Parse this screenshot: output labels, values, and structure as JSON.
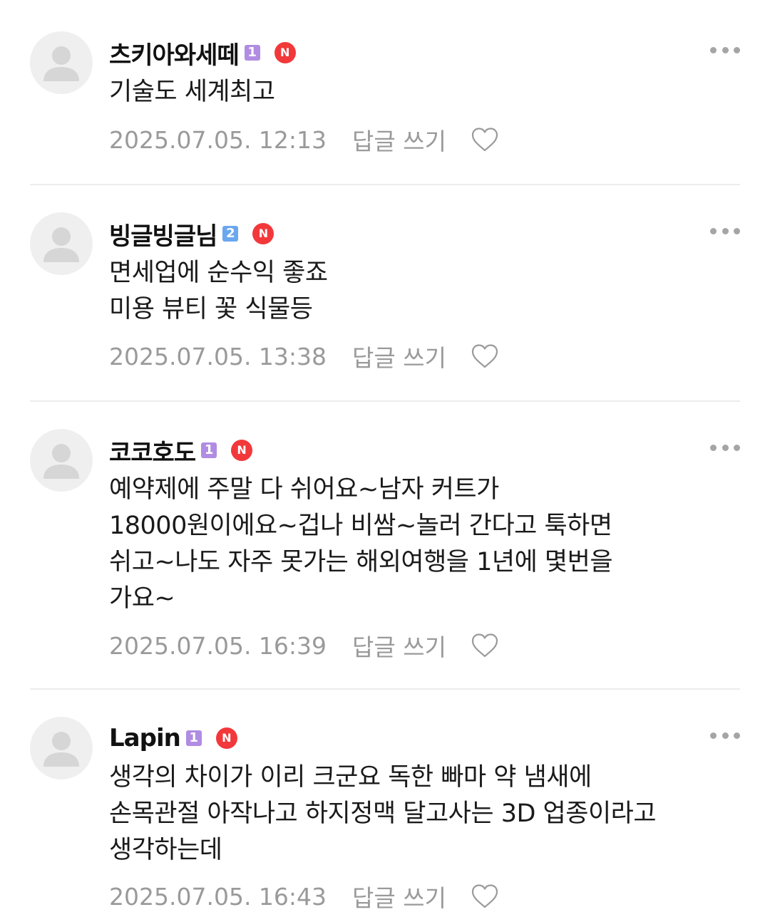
{
  "colors": {
    "grade_1": "#b08ce3",
    "grade_2": "#6aa7ee",
    "new_badge": "#f2383a",
    "meta_text": "#9a9a9a"
  },
  "reply_label": "답글 쓰기",
  "comments": [
    {
      "nickname": "츠키아와세떼",
      "grade": "1",
      "new_label": "N",
      "text": "기술도 세계최고",
      "timestamp": "2025.07.05. 12:13"
    },
    {
      "nickname": "빙글빙글님",
      "grade": "2",
      "new_label": "N",
      "text": "면세업에 순수익 좋죠\n미용 뷰티 꽃 식물등",
      "timestamp": "2025.07.05. 13:38"
    },
    {
      "nickname": "코코호도",
      "grade": "1",
      "new_label": "N",
      "text": "예약제에 주말 다 쉬어요~남자 커트가\n18000원이에요~겁나 비쌈~놀러 간다고 툭하면\n쉬고~나도 자주 못가는 해외여행을 1년에 몇번을\n가요~",
      "timestamp": "2025.07.05. 16:39"
    },
    {
      "nickname": "Lapin",
      "grade": "1",
      "new_label": "N",
      "text": "생각의 차이가 이리 크군요 독한 빠마 약 냄새에\n손목관절 아작나고 하지정맥 달고사는 3D 업종이라고\n생각하는데",
      "timestamp": "2025.07.05. 16:43"
    }
  ]
}
